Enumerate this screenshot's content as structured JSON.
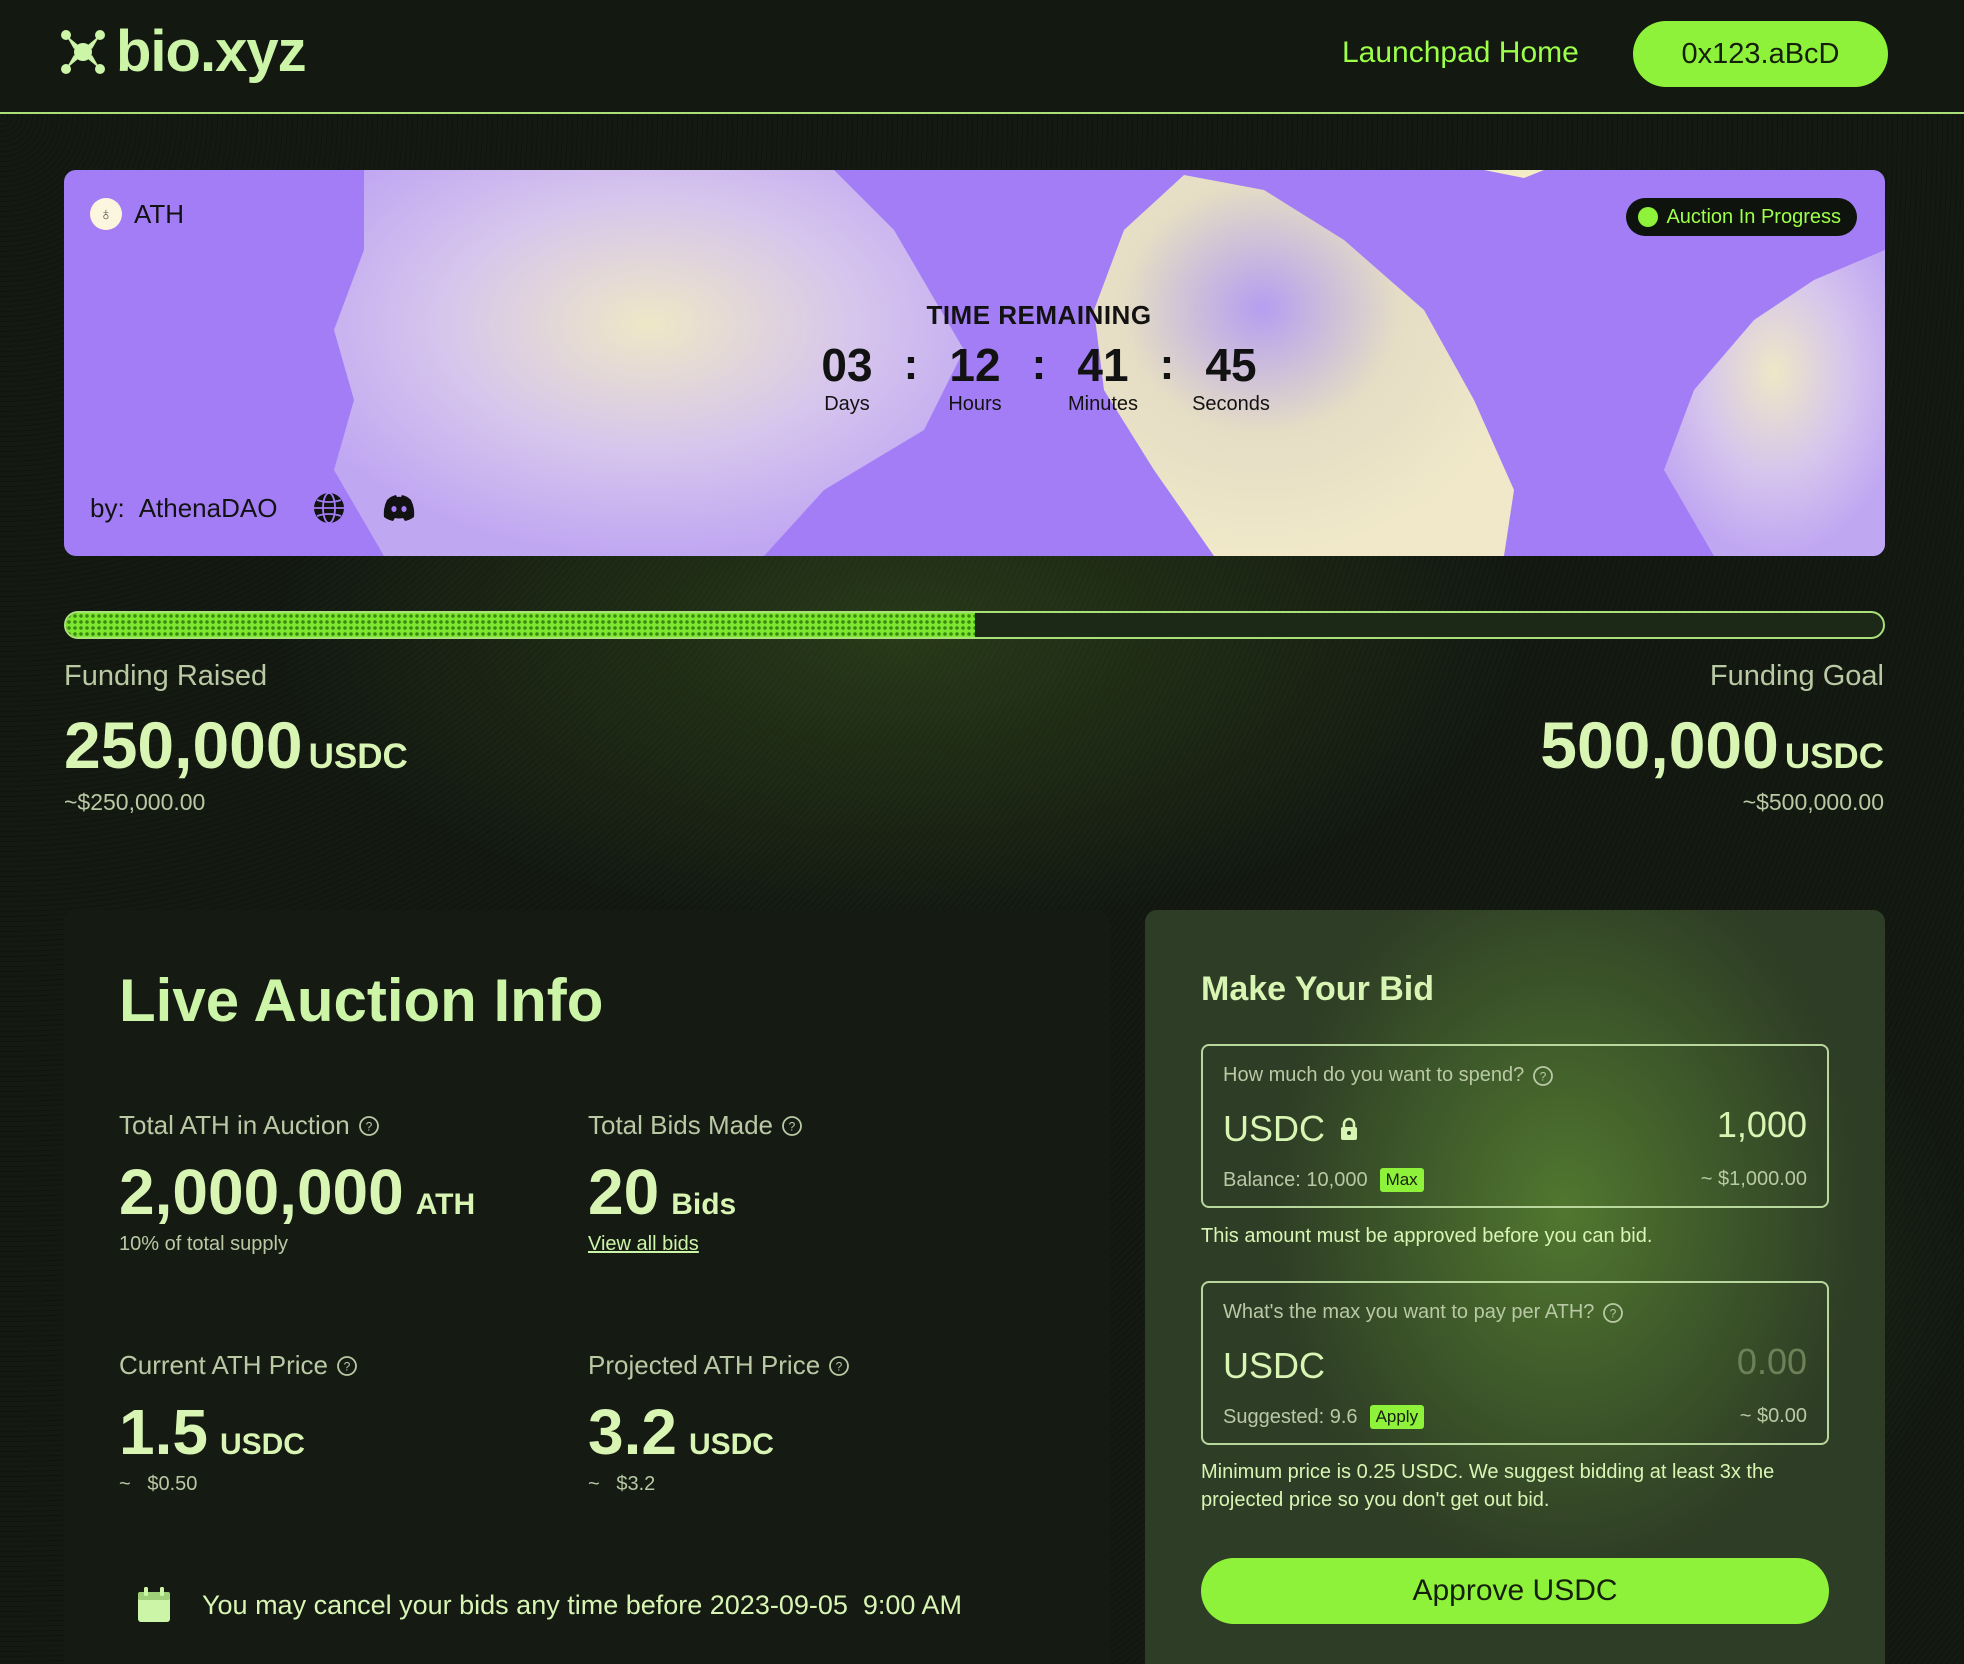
{
  "header": {
    "logo_text": "bio.xyz",
    "nav_home": "Launchpad Home",
    "wallet": "0x123.aBcD"
  },
  "banner": {
    "token": "ATH",
    "status": "Auction In Progress",
    "countdown": {
      "title": "TIME REMAINING",
      "days": "03",
      "days_label": "Days",
      "hours": "12",
      "hours_label": "Hours",
      "minutes": "41",
      "minutes_label": "Minutes",
      "seconds": "45",
      "seconds_label": "Seconds",
      "separator": ":"
    },
    "by_label": "by:",
    "by_name": "AthenaDAO",
    "icons": [
      "globe-icon",
      "discord-icon"
    ]
  },
  "funding": {
    "progress_fraction": 0.5,
    "raised_label": "Funding Raised",
    "raised_amount": "250,000",
    "raised_unit": "USDC",
    "raised_usd": "~$250,000.00",
    "goal_label": "Funding Goal",
    "goal_amount": "500,000",
    "goal_unit": "USDC",
    "goal_usd": "~$500,000.00"
  },
  "auction_info": {
    "title": "Live Auction Info",
    "total_ath": {
      "label": "Total ATH in Auction",
      "value": "2,000,000",
      "unit": "ATH",
      "sub": "10% of total supply"
    },
    "total_bids": {
      "label": "Total Bids Made",
      "value": "20",
      "unit": "Bids",
      "link": "View all bids"
    },
    "current_price": {
      "label": "Current ATH Price",
      "value": "1.5",
      "unit": "USDC",
      "sub": "~   $0.50"
    },
    "projected_price": {
      "label": "Projected ATH Price",
      "value": "3.2",
      "unit": "USDC",
      "sub": "~   $3.2"
    },
    "cancel_notice": "You may cancel your bids any time before 2023-09-05  9:00 AM"
  },
  "bid": {
    "title": "Make Your Bid",
    "spend": {
      "question": "How much do you want to spend?",
      "token": "USDC",
      "value": "1,000",
      "balance": "Balance: 10,000",
      "chip": "Max",
      "usd": "~ $1,000.00"
    },
    "spend_note": "This amount must be approved before you can bid.",
    "max_price": {
      "question": "What's the max you want to pay per ATH?",
      "token": "USDC",
      "placeholder": "0.00",
      "suggested": "Suggested: 9.6",
      "chip": "Apply",
      "usd": "~ $0.00"
    },
    "price_note": "Minimum price is 0.25 USDC. We suggest bidding at least 3x the projected price so you don't get out bid.",
    "approve_label": "Approve USDC"
  },
  "colors": {
    "background": "#141a12",
    "accent": "#8ff23a",
    "banner": "#a37df6",
    "text": "#d8f5b4"
  }
}
